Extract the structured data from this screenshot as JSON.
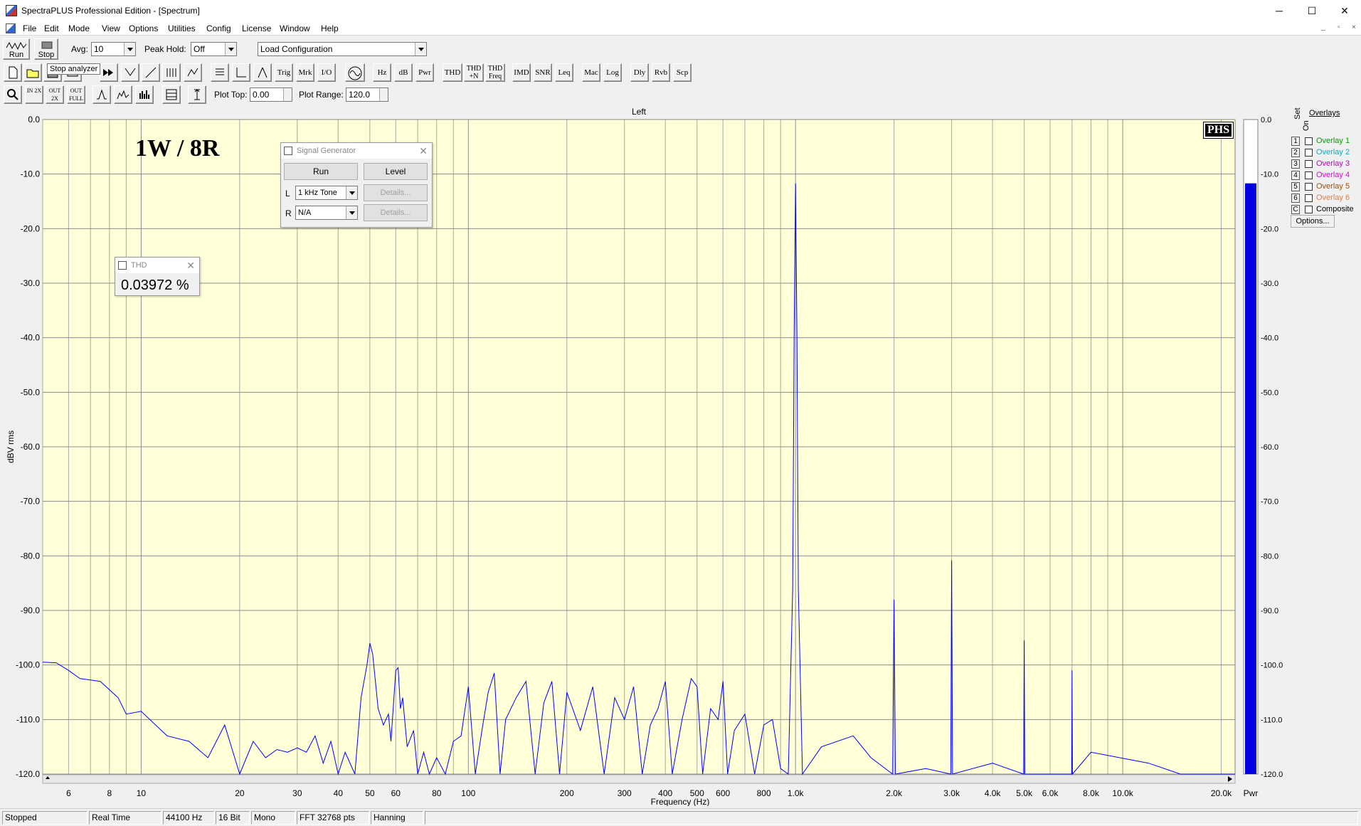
{
  "window": {
    "title": "SpectraPLUS Professional Edition - [Spectrum]",
    "min_glyph": "─",
    "max_glyph": "☐",
    "close_glyph": "✕"
  },
  "menu": [
    "File",
    "Edit",
    "Mode",
    "View",
    "Options",
    "Utilities",
    "Config",
    "License",
    "Window",
    "Help"
  ],
  "mdi": [
    "_",
    "▫",
    "×"
  ],
  "toolbar1": {
    "run_label": "Run",
    "stop_label": "Stop",
    "avg_label": "Avg:",
    "avg_value": "10",
    "peak_hold_label": "Peak Hold:",
    "peak_hold_value": "Off",
    "config_value": "Load Configuration",
    "tooltip": "Stop analyzer"
  },
  "toolbar2": {
    "text_buttons": [
      "Trig",
      "Mrk",
      "I/O",
      "Hz",
      "dB",
      "Pwr",
      "THD",
      "THD +N",
      "THD Freq",
      "IMD",
      "SNR",
      "Leq",
      "Mac",
      "Log",
      "Dly",
      "Rvb",
      "Scp"
    ]
  },
  "toolbar3": {
    "zoom_buttons": [
      "IN 2X",
      "OUT 2X",
      "OUT FULL"
    ],
    "plot_top_label": "Plot Top:",
    "plot_top_value": "0.00",
    "plot_range_label": "Plot Range:",
    "plot_range_value": "120.0"
  },
  "annotation": {
    "title": "1W / 8R",
    "logo": "PHS"
  },
  "signal_generator": {
    "title": "Signal Generator",
    "run_label": "Run",
    "level_label": "Level",
    "left_label": "L",
    "left_value": "1 kHz Tone",
    "right_label": "R",
    "right_value": "N/A",
    "details_label": "Details..."
  },
  "thd_window": {
    "title": "THD",
    "value": "0.03972 %"
  },
  "overlays": {
    "title": "Overlays",
    "set_label": "Set",
    "on_label": "On",
    "items": [
      {
        "num": "1",
        "label": "Overlay 1",
        "color": "#00a000"
      },
      {
        "num": "2",
        "label": "Overlay 2",
        "color": "#00b0c0"
      },
      {
        "num": "3",
        "label": "Overlay 3",
        "color": "#c000c0"
      },
      {
        "num": "4",
        "label": "Overlay 4",
        "color": "#e000e0"
      },
      {
        "num": "5",
        "label": "Overlay 5",
        "color": "#a05000"
      },
      {
        "num": "6",
        "label": "Overlay 6",
        "color": "#e08040"
      },
      {
        "num": "C",
        "label": "Composite",
        "color": "#000000"
      }
    ],
    "options_label": "Options..."
  },
  "status": [
    "Stopped",
    "Real Time",
    "44100 Hz",
    "16 Bit",
    "Mono",
    "FFT 32768 pts",
    "Hanning"
  ],
  "chart_data": {
    "type": "line",
    "title": "Left",
    "xlabel": "Frequency (Hz)",
    "ylabel": "dBV rms",
    "x_scale": "log",
    "xlim": [
      5,
      22050
    ],
    "ylim": [
      -120,
      0
    ],
    "grid": true,
    "background": "#ffffd8",
    "line_color": "#0000ff",
    "x_ticks": [
      {
        "v": 6,
        "t": "6"
      },
      {
        "v": 8,
        "t": "8"
      },
      {
        "v": 10,
        "t": "10"
      },
      {
        "v": 20,
        "t": "20"
      },
      {
        "v": 30,
        "t": "30"
      },
      {
        "v": 40,
        "t": "40"
      },
      {
        "v": 50,
        "t": "50"
      },
      {
        "v": 60,
        "t": "60"
      },
      {
        "v": 80,
        "t": "80"
      },
      {
        "v": 100,
        "t": "100"
      },
      {
        "v": 200,
        "t": "200"
      },
      {
        "v": 300,
        "t": "300"
      },
      {
        "v": 400,
        "t": "400"
      },
      {
        "v": 500,
        "t": "500"
      },
      {
        "v": 600,
        "t": "600"
      },
      {
        "v": 800,
        "t": "800"
      },
      {
        "v": 1000,
        "t": "1.0k"
      },
      {
        "v": 2000,
        "t": "2.0k"
      },
      {
        "v": 3000,
        "t": "3.0k"
      },
      {
        "v": 4000,
        "t": "4.0k"
      },
      {
        "v": 5000,
        "t": "5.0k"
      },
      {
        "v": 6000,
        "t": "6.0k"
      },
      {
        "v": 8000,
        "t": "8.0k"
      },
      {
        "v": 10000,
        "t": "10.0k"
      },
      {
        "v": 20000,
        "t": "20.0k"
      }
    ],
    "y_ticks": [
      "0.0",
      "-10.0",
      "-20.0",
      "-30.0",
      "-40.0",
      "-50.0",
      "-60.0",
      "-70.0",
      "-80.0",
      "-90.0",
      "-100.0",
      "-110.0",
      "-120.0"
    ],
    "series": [
      {
        "points": [
          [
            5,
            -99.5
          ],
          [
            5.5,
            -99.6
          ],
          [
            6,
            -101
          ],
          [
            6.5,
            -102.5
          ],
          [
            7.5,
            -103
          ],
          [
            8.5,
            -106
          ],
          [
            9,
            -109
          ],
          [
            10,
            -108.5
          ],
          [
            12,
            -113
          ],
          [
            14,
            -114
          ],
          [
            16,
            -117
          ],
          [
            18,
            -111
          ],
          [
            20,
            -120
          ],
          [
            22,
            -114
          ],
          [
            24,
            -117
          ],
          [
            26,
            -115.5
          ],
          [
            28,
            -116
          ],
          [
            30,
            -115.2
          ],
          [
            32,
            -116
          ],
          [
            34,
            -113
          ],
          [
            36,
            -118
          ],
          [
            38,
            -114
          ],
          [
            40,
            -120
          ],
          [
            42,
            -116
          ],
          [
            45,
            -120
          ],
          [
            47,
            -106
          ],
          [
            49,
            -100
          ],
          [
            50,
            -96
          ],
          [
            51,
            -98
          ],
          [
            53,
            -108
          ],
          [
            55,
            -111
          ],
          [
            57,
            -109
          ],
          [
            58,
            -114
          ],
          [
            60,
            -101
          ],
          [
            61,
            -100.5
          ],
          [
            62,
            -108
          ],
          [
            63,
            -106
          ],
          [
            65,
            -115
          ],
          [
            68,
            -112
          ],
          [
            70,
            -120
          ],
          [
            73,
            -116
          ],
          [
            76,
            -120
          ],
          [
            80,
            -117
          ],
          [
            85,
            -120
          ],
          [
            90,
            -114
          ],
          [
            95,
            -113
          ],
          [
            100,
            -104
          ],
          [
            105,
            -120
          ],
          [
            110,
            -112
          ],
          [
            115,
            -105
          ],
          [
            120,
            -101.5
          ],
          [
            125,
            -120
          ],
          [
            130,
            -110
          ],
          [
            140,
            -106
          ],
          [
            150,
            -103
          ],
          [
            160,
            -120
          ],
          [
            170,
            -107
          ],
          [
            180,
            -103
          ],
          [
            190,
            -120
          ],
          [
            200,
            -105
          ],
          [
            220,
            -112
          ],
          [
            240,
            -104
          ],
          [
            260,
            -120
          ],
          [
            280,
            -106
          ],
          [
            300,
            -110
          ],
          [
            320,
            -104
          ],
          [
            340,
            -120
          ],
          [
            360,
            -111
          ],
          [
            380,
            -108
          ],
          [
            400,
            -103
          ],
          [
            420,
            -120
          ],
          [
            450,
            -110
          ],
          [
            480,
            -102.5
          ],
          [
            500,
            -104
          ],
          [
            520,
            -120
          ],
          [
            550,
            -108
          ],
          [
            580,
            -110
          ],
          [
            600,
            -103
          ],
          [
            620,
            -120
          ],
          [
            650,
            -112
          ],
          [
            700,
            -109
          ],
          [
            750,
            -120
          ],
          [
            800,
            -111
          ],
          [
            850,
            -110
          ],
          [
            900,
            -119
          ],
          [
            950,
            -120
          ],
          [
            980,
            -86
          ],
          [
            990,
            -40
          ],
          [
            1000,
            -11.7
          ],
          [
            1010,
            -40
          ],
          [
            1020,
            -86
          ],
          [
            1050,
            -120
          ],
          [
            1200,
            -115
          ],
          [
            1500,
            -113
          ],
          [
            1700,
            -117
          ],
          [
            1980,
            -120
          ],
          [
            2000,
            -88
          ],
          [
            2020,
            -120
          ],
          [
            2500,
            -119
          ],
          [
            2980,
            -120
          ],
          [
            3000,
            -80.8
          ],
          [
            3020,
            -120
          ],
          [
            4000,
            -118
          ],
          [
            4980,
            -120
          ],
          [
            5000,
            -95.5
          ],
          [
            5020,
            -120
          ],
          [
            6980,
            -120
          ],
          [
            7000,
            -101
          ],
          [
            7020,
            -120
          ],
          [
            8000,
            -116
          ],
          [
            12000,
            -118
          ],
          [
            15000,
            -120
          ],
          [
            22050,
            -120
          ]
        ]
      }
    ],
    "meter": {
      "label": "Pwr",
      "level_db": -11.7,
      "color": "#0000e0"
    }
  }
}
